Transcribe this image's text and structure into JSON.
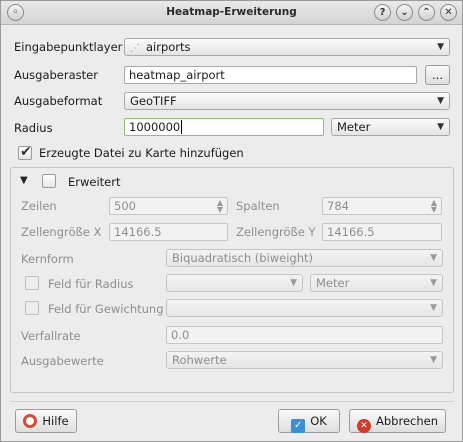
{
  "window": {
    "title": "Heatmap-Erweiterung",
    "title_buttons": [
      "?",
      "⌄",
      "⌃",
      "✕"
    ],
    "menu_button": "◦"
  },
  "fields": {
    "input_layer_label": "Eingabepunktlayer",
    "input_layer_value": "airports",
    "output_raster_label": "Ausgaberaster",
    "output_raster_value": "heatmap_airport",
    "browse_label": "...",
    "output_format_label": "Ausgabeformat",
    "output_format_value": "GeoTIFF",
    "radius_label": "Radius",
    "radius_value": "1000000",
    "radius_unit": "Meter",
    "add_to_map_label": "Erzeugte Datei zu Karte hinzufügen",
    "add_to_map_checked": true
  },
  "advanced": {
    "label": "Erweitert",
    "enabled": false,
    "rows_label": "Zeilen",
    "rows_value": "500",
    "cols_label": "Spalten",
    "cols_value": "784",
    "cellsize_x_label": "Zellengröße X",
    "cellsize_x_value": "14166.5",
    "cellsize_y_label": "Zellengröße Y",
    "cellsize_y_value": "14166.5",
    "kernel_label": "Kernform",
    "kernel_value": "Biquadratisch (biweight)",
    "radius_field_label": "Feld für Radius",
    "radius_field_unit": "Meter",
    "weight_field_label": "Feld für Gewichtung",
    "decay_label": "Verfallrate",
    "decay_value": "0.0",
    "output_values_label": "Ausgabewerte",
    "output_values_value": "Rohwerte"
  },
  "buttons": {
    "help": "Hilfe",
    "ok": "OK",
    "cancel": "Abbrechen"
  },
  "colors": {
    "focus_border": "#8fc073",
    "ok_icon": "#3a8fd6",
    "cancel_icon": "#d23a2a"
  }
}
